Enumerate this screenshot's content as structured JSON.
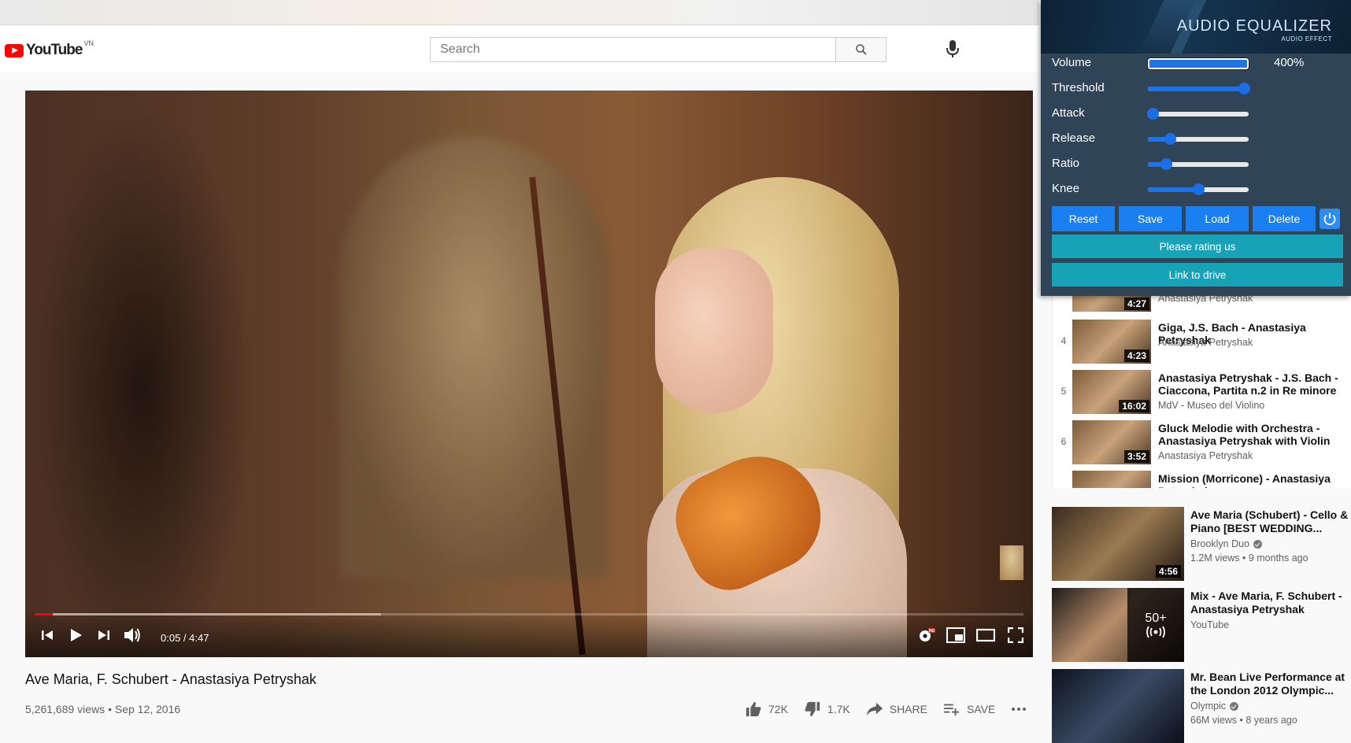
{
  "masthead": {
    "logo_text": "YouTube",
    "country_code": "VN",
    "search_placeholder": "Search"
  },
  "player": {
    "current_time": "0:05",
    "duration": "4:47",
    "time_display": "0:05 / 4:47",
    "played_fraction": 0.018,
    "buffered_fraction": 0.35
  },
  "video": {
    "title": "Ave Maria, F. Schubert - Anastasiya Petryshak",
    "views": "5,261,689 views",
    "date": "Sep 12, 2016",
    "meta": "5,261,689 views • Sep 12, 2016",
    "likes": "72K",
    "dislikes": "1.7K",
    "share_label": "SHARE",
    "save_label": "SAVE"
  },
  "playlist": {
    "items": [
      {
        "index": "",
        "title": "",
        "channel": "Anastasiya Petryshak",
        "duration": "4:27"
      },
      {
        "index": "4",
        "title": "Giga, J.S. Bach - Anastasiya Petryshak",
        "channel": "Anastasiya Petryshak",
        "duration": "4:23"
      },
      {
        "index": "5",
        "title": "Anastasiya Petryshak - J.S. Bach - Ciaccona, Partita n.2 in Re minore",
        "channel": "MdV - Museo del Violino",
        "duration": "16:02"
      },
      {
        "index": "6",
        "title": "Gluck Melodie with Orchestra - Anastasiya Petryshak with Violin of...",
        "channel": "Anastasiya Petryshak",
        "duration": "3:52"
      },
      {
        "index": "",
        "title": "Mission (Morricone) - Anastasiya Petryshak",
        "channel": "",
        "duration": ""
      }
    ]
  },
  "recommendations": [
    {
      "title": "Ave Maria (Schubert) - Cello & Piano [BEST WEDDING...",
      "channel": "Brooklyn Duo",
      "verified": true,
      "views": "1.2M views • 9 months ago",
      "duration": "4:56"
    },
    {
      "title": "Mix - Ave Maria, F. Schubert - Anastasiya Petryshak",
      "channel": "YouTube",
      "verified": false,
      "views": "",
      "mix_count": "50+"
    },
    {
      "title": "Mr. Bean Live Performance at the London 2012 Olympic...",
      "channel": "Olympic",
      "verified": true,
      "views": "66M views • 8 years ago"
    }
  ],
  "equalizer": {
    "title": "AUDIO EQUALIZER",
    "subtitle": "AUDIO EFFECT",
    "sliders": [
      {
        "label": "Volume",
        "value": 1.0,
        "display": "400%"
      },
      {
        "label": "Threshold",
        "value": 0.95
      },
      {
        "label": "Attack",
        "value": 0.05
      },
      {
        "label": "Release",
        "value": 0.22
      },
      {
        "label": "Ratio",
        "value": 0.18
      },
      {
        "label": "Knee",
        "value": 0.5
      }
    ],
    "buttons": {
      "reset": "Reset",
      "save": "Save",
      "load": "Load",
      "delete": "Delete"
    },
    "rate_label": "Please rating us",
    "drive_label": "Link to drive",
    "accent_color": "#1a7ff0",
    "teal_color": "#17a2b8"
  }
}
